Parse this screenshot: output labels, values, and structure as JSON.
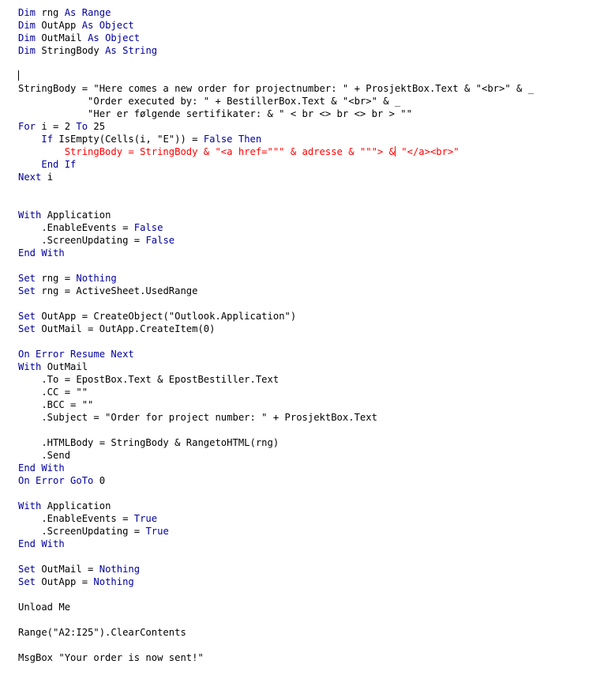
{
  "editor": {
    "language": "VBA",
    "background_color": "#FFFFFF",
    "keyword_color": "#0000A0",
    "plain_color": "#000000",
    "error_color": "#FF0000",
    "font_size_px": 12,
    "line_height_px": 16,
    "caret_visible": true
  },
  "code": {
    "lines": [
      {
        "n": 1,
        "indent": 0,
        "tokens": [
          {
            "t": "kw",
            "s": "Dim"
          },
          {
            "t": "plain",
            "s": " rng "
          },
          {
            "t": "kw",
            "s": "As"
          },
          {
            "t": "plain",
            "s": " "
          },
          {
            "t": "kw",
            "s": "Range"
          }
        ]
      },
      {
        "n": 2,
        "indent": 0,
        "tokens": [
          {
            "t": "kw",
            "s": "Dim"
          },
          {
            "t": "plain",
            "s": " OutApp "
          },
          {
            "t": "kw",
            "s": "As"
          },
          {
            "t": "plain",
            "s": " "
          },
          {
            "t": "kw",
            "s": "Object"
          }
        ]
      },
      {
        "n": 3,
        "indent": 0,
        "tokens": [
          {
            "t": "kw",
            "s": "Dim"
          },
          {
            "t": "plain",
            "s": " OutMail "
          },
          {
            "t": "kw",
            "s": "As"
          },
          {
            "t": "plain",
            "s": " "
          },
          {
            "t": "kw",
            "s": "Object"
          }
        ]
      },
      {
        "n": 4,
        "indent": 0,
        "tokens": [
          {
            "t": "kw",
            "s": "Dim"
          },
          {
            "t": "plain",
            "s": " StringBody "
          },
          {
            "t": "kw",
            "s": "As"
          },
          {
            "t": "plain",
            "s": " "
          },
          {
            "t": "kw",
            "s": "String"
          }
        ]
      },
      {
        "n": 5,
        "indent": 0,
        "tokens": []
      },
      {
        "n": 6,
        "indent": 0,
        "caret": true,
        "tokens": []
      },
      {
        "n": 7,
        "indent": 0,
        "tokens": [
          {
            "t": "plain",
            "s": "StringBody = \"Here comes a new order for projectnumber: \" + ProsjektBox.Text & \"<br>\" & _"
          }
        ]
      },
      {
        "n": 8,
        "indent": 0,
        "tokens": [
          {
            "t": "plain",
            "s": "            \"Order executed by: \" + BestillerBox.Text & \"<br>\" & _"
          }
        ]
      },
      {
        "n": 9,
        "indent": 0,
        "tokens": [
          {
            "t": "plain",
            "s": "            \"Her er følgende sertifikater: & \" < br <> br <> br > \"\""
          }
        ]
      },
      {
        "n": 10,
        "indent": 0,
        "tokens": [
          {
            "t": "kw",
            "s": "For"
          },
          {
            "t": "plain",
            "s": " i = 2 "
          },
          {
            "t": "kw",
            "s": "To"
          },
          {
            "t": "plain",
            "s": " 25"
          }
        ]
      },
      {
        "n": 11,
        "indent": 0,
        "tokens": [
          {
            "t": "plain",
            "s": "    "
          },
          {
            "t": "kw",
            "s": "If"
          },
          {
            "t": "plain",
            "s": " IsEmpty(Cells(i, \"E\")) = "
          },
          {
            "t": "kw",
            "s": "False"
          },
          {
            "t": "plain",
            "s": " "
          },
          {
            "t": "kw",
            "s": "Then"
          }
        ]
      },
      {
        "n": 12,
        "indent": 0,
        "redcaret": true,
        "tokens": [
          {
            "t": "red",
            "s": "        StringBody = StringBody & \"<a href=\"\"\" & adresse & \"\"\"> &"
          },
          {
            "t": "red",
            "s": " \"</a><br>\""
          }
        ]
      },
      {
        "n": 13,
        "indent": 0,
        "tokens": [
          {
            "t": "plain",
            "s": "    "
          },
          {
            "t": "kw",
            "s": "End If"
          }
        ]
      },
      {
        "n": 14,
        "indent": 0,
        "tokens": [
          {
            "t": "kw",
            "s": "Next"
          },
          {
            "t": "plain",
            "s": " i"
          }
        ]
      },
      {
        "n": 15,
        "indent": 0,
        "tokens": []
      },
      {
        "n": 16,
        "indent": 0,
        "tokens": []
      },
      {
        "n": 17,
        "indent": 0,
        "tokens": [
          {
            "t": "kw",
            "s": "With"
          },
          {
            "t": "plain",
            "s": " Application"
          }
        ]
      },
      {
        "n": 18,
        "indent": 0,
        "tokens": [
          {
            "t": "plain",
            "s": "    .EnableEvents = "
          },
          {
            "t": "kw",
            "s": "False"
          }
        ]
      },
      {
        "n": 19,
        "indent": 0,
        "tokens": [
          {
            "t": "plain",
            "s": "    .ScreenUpdating = "
          },
          {
            "t": "kw",
            "s": "False"
          }
        ]
      },
      {
        "n": 20,
        "indent": 0,
        "tokens": [
          {
            "t": "kw",
            "s": "End With"
          }
        ]
      },
      {
        "n": 21,
        "indent": 0,
        "tokens": []
      },
      {
        "n": 22,
        "indent": 0,
        "tokens": [
          {
            "t": "kw",
            "s": "Set"
          },
          {
            "t": "plain",
            "s": " rng = "
          },
          {
            "t": "kw",
            "s": "Nothing"
          }
        ]
      },
      {
        "n": 23,
        "indent": 0,
        "tokens": [
          {
            "t": "kw",
            "s": "Set"
          },
          {
            "t": "plain",
            "s": " rng = ActiveSheet.UsedRange"
          }
        ]
      },
      {
        "n": 24,
        "indent": 0,
        "tokens": []
      },
      {
        "n": 25,
        "indent": 0,
        "tokens": [
          {
            "t": "kw",
            "s": "Set"
          },
          {
            "t": "plain",
            "s": " OutApp = CreateObject(\"Outlook.Application\")"
          }
        ]
      },
      {
        "n": 26,
        "indent": 0,
        "tokens": [
          {
            "t": "kw",
            "s": "Set"
          },
          {
            "t": "plain",
            "s": " OutMail = OutApp.CreateItem(0)"
          }
        ]
      },
      {
        "n": 27,
        "indent": 0,
        "tokens": []
      },
      {
        "n": 28,
        "indent": 0,
        "tokens": [
          {
            "t": "kw",
            "s": "On Error Resume Next"
          }
        ]
      },
      {
        "n": 29,
        "indent": 0,
        "tokens": [
          {
            "t": "kw",
            "s": "With"
          },
          {
            "t": "plain",
            "s": " OutMail"
          }
        ]
      },
      {
        "n": 30,
        "indent": 0,
        "tokens": [
          {
            "t": "plain",
            "s": "    .To = EpostBox.Text & EpostBestiller.Text"
          }
        ]
      },
      {
        "n": 31,
        "indent": 0,
        "tokens": [
          {
            "t": "plain",
            "s": "    .CC = \"\""
          }
        ]
      },
      {
        "n": 32,
        "indent": 0,
        "tokens": [
          {
            "t": "plain",
            "s": "    .BCC = \"\""
          }
        ]
      },
      {
        "n": 33,
        "indent": 0,
        "tokens": [
          {
            "t": "plain",
            "s": "    .Subject = \"Order for project number: \" + ProsjektBox.Text"
          }
        ]
      },
      {
        "n": 34,
        "indent": 0,
        "tokens": []
      },
      {
        "n": 35,
        "indent": 0,
        "tokens": [
          {
            "t": "plain",
            "s": "    .HTMLBody = StringBody & RangetoHTML(rng)"
          }
        ]
      },
      {
        "n": 36,
        "indent": 0,
        "tokens": [
          {
            "t": "plain",
            "s": "    .Send"
          }
        ]
      },
      {
        "n": 37,
        "indent": 0,
        "tokens": [
          {
            "t": "kw",
            "s": "End With"
          }
        ]
      },
      {
        "n": 38,
        "indent": 0,
        "tokens": [
          {
            "t": "kw",
            "s": "On Error GoTo"
          },
          {
            "t": "plain",
            "s": " 0"
          }
        ]
      },
      {
        "n": 39,
        "indent": 0,
        "tokens": []
      },
      {
        "n": 40,
        "indent": 0,
        "tokens": [
          {
            "t": "kw",
            "s": "With"
          },
          {
            "t": "plain",
            "s": " Application"
          }
        ]
      },
      {
        "n": 41,
        "indent": 0,
        "tokens": [
          {
            "t": "plain",
            "s": "    .EnableEvents = "
          },
          {
            "t": "kw",
            "s": "True"
          }
        ]
      },
      {
        "n": 42,
        "indent": 0,
        "tokens": [
          {
            "t": "plain",
            "s": "    .ScreenUpdating = "
          },
          {
            "t": "kw",
            "s": "True"
          }
        ]
      },
      {
        "n": 43,
        "indent": 0,
        "tokens": [
          {
            "t": "kw",
            "s": "End With"
          }
        ]
      },
      {
        "n": 44,
        "indent": 0,
        "tokens": []
      },
      {
        "n": 45,
        "indent": 0,
        "tokens": [
          {
            "t": "kw",
            "s": "Set"
          },
          {
            "t": "plain",
            "s": " OutMail = "
          },
          {
            "t": "kw",
            "s": "Nothing"
          }
        ]
      },
      {
        "n": 46,
        "indent": 0,
        "tokens": [
          {
            "t": "kw",
            "s": "Set"
          },
          {
            "t": "plain",
            "s": " OutApp = "
          },
          {
            "t": "kw",
            "s": "Nothing"
          }
        ]
      },
      {
        "n": 47,
        "indent": 0,
        "tokens": []
      },
      {
        "n": 48,
        "indent": 0,
        "tokens": [
          {
            "t": "plain",
            "s": "Unload Me"
          }
        ]
      },
      {
        "n": 49,
        "indent": 0,
        "tokens": []
      },
      {
        "n": 50,
        "indent": 0,
        "tokens": [
          {
            "t": "plain",
            "s": "Range(\"A2:I25\").ClearContents"
          }
        ]
      },
      {
        "n": 51,
        "indent": 0,
        "tokens": []
      },
      {
        "n": 52,
        "indent": 0,
        "tokens": [
          {
            "t": "plain",
            "s": "MsgBox \"Your order is now sent!\""
          }
        ]
      }
    ]
  }
}
